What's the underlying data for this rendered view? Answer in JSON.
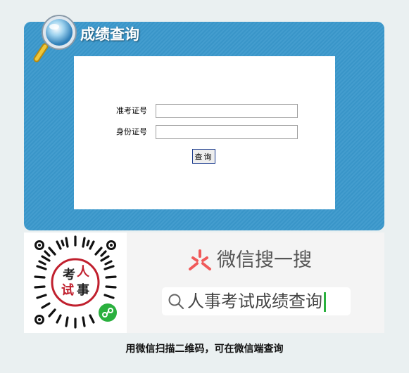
{
  "header": {
    "title": "成绩查询",
    "icon": "magnifier-icon"
  },
  "form": {
    "exam_id_label": "准考证号",
    "exam_id_value": "",
    "id_card_label": "身份证号",
    "id_card_value": "",
    "query_button": "查询"
  },
  "wechat": {
    "search_label": "微信搜一搜",
    "search_query": "人事考试成绩查询",
    "qr_text_1": "考",
    "qr_text_2": "人",
    "qr_text_3": "试",
    "qr_text_4": "事",
    "caption": "用微信扫描二维码，可在微信端查询"
  },
  "colors": {
    "panel": "#3a98cc",
    "background": "#eaf0f1",
    "qr_red": "#c0202e",
    "wechat_red": "#f05a5a",
    "caret_green": "#2ab03e"
  }
}
